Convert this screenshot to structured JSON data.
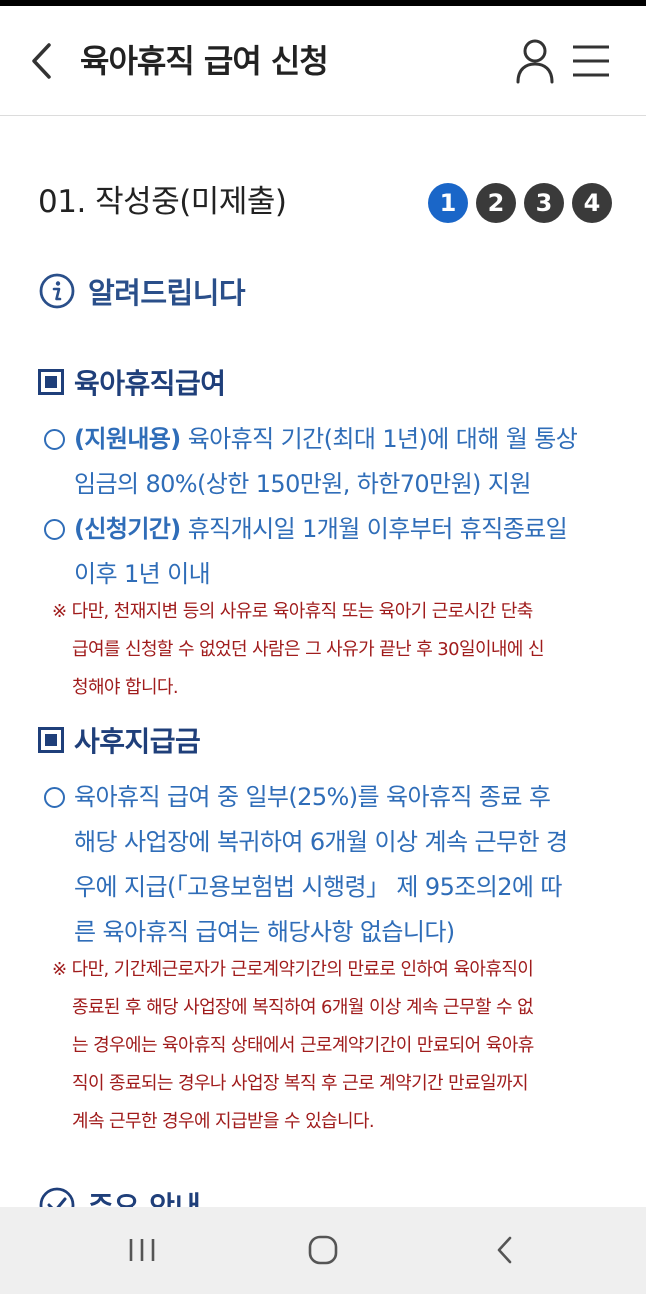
{
  "header": {
    "title": "육아휴직 급여 신청"
  },
  "status": {
    "step_title": "01. 작성중(미제출)",
    "steps": [
      "1",
      "2",
      "3",
      "4"
    ],
    "active_step": 1
  },
  "notice": {
    "title": "알려드립니다"
  },
  "section1": {
    "title": "육아휴직급여",
    "bullet1_label": "(지원내용)",
    "bullet1_line1": " 육아휴직 기간(최대 1년)에 대해 월 통상",
    "bullet1_line2": "임금의 80%(상한 150만원, 하한70만원) 지원",
    "bullet2_label": "(신청기간)",
    "bullet2_line1": " 휴직개시일 1개월 이후부터 휴직종료일",
    "bullet2_line2": "이후 1년 이내",
    "note_line1": "※ 다만, 천재지변 등의 사유로 육아휴직 또는 육아기 근로시간 단축",
    "note_line2": "급여를 신청할 수 없었던 사람은 그 사유가 끝난 후 30일이내에 신",
    "note_line3": "청해야 합니다."
  },
  "section2": {
    "title": "사후지급금",
    "bullet_line1": "육아휴직 급여 중 일부(25%)를 육아휴직 종료 후",
    "bullet_line2": "해당 사업장에 복귀하여 6개월 이상 계속 근무한 경",
    "bullet_line3": "우에 지급(「고용보험법 시행령」 제 95조의2에 따",
    "bullet_line4": "른 육아휴직 급여는 해당사항 없습니다)",
    "note_line1": "※ 다만, 기간제근로자가 근로계약기간의 만료로 인하여 육아휴직이",
    "note_line2": "종료된 후 해당 사업장에 복직하여 6개월 이상 계속 근무할 수 없",
    "note_line3": "는 경우에는 육아휴직 상태에서 근로계약기간이 만료되어 육아휴",
    "note_line4": "직이 종료되는 경우나 사업장 복직 후 근로 계약기간 만료일까지",
    "note_line5": "계속 근무한 경우에 지급받을 수 있습니다."
  },
  "section3": {
    "title": "주요 안내"
  },
  "colors": {
    "accent": "#1a66c8",
    "heading": "#1f3f7a",
    "body_blue": "#2f6db8",
    "warning": "#a01c1c"
  }
}
